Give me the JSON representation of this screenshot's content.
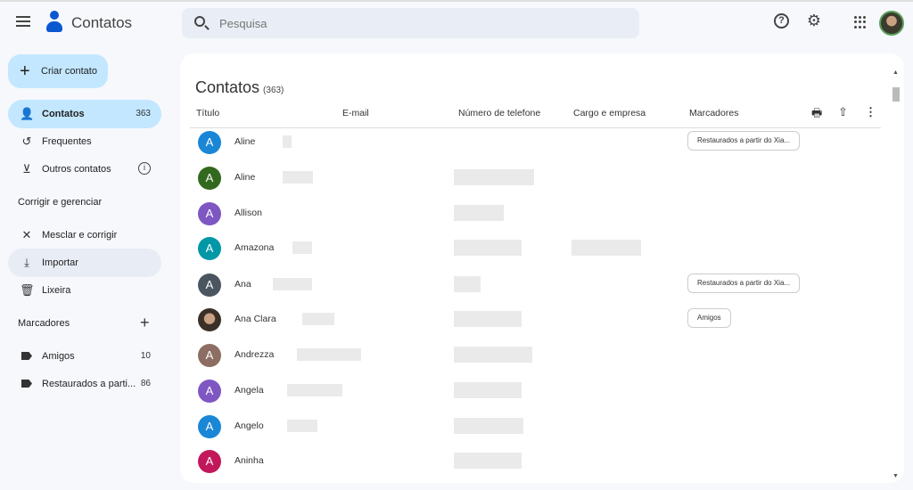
{
  "app": {
    "title": "Contatos"
  },
  "search": {
    "placeholder": "Pesquisa"
  },
  "topbar": {
    "help_glyph": "?",
    "settings_glyph": "⚙"
  },
  "sidebar": {
    "create_label": "Criar contato",
    "items": [
      {
        "label": "Contatos",
        "count": "363",
        "icon": "person-icon"
      },
      {
        "label": "Frequentes",
        "icon": "history-icon"
      },
      {
        "label": "Outros contatos",
        "icon": "archive-download-icon"
      }
    ],
    "fix_section": "Corrigir e gerenciar",
    "fix_items": [
      {
        "label": "Mesclar e corrigir",
        "icon": "tools-icon"
      },
      {
        "label": "Importar",
        "icon": "download-icon"
      },
      {
        "label": "Lixeira",
        "icon": "trash-icon"
      }
    ],
    "labels_section": "Marcadores",
    "labels": [
      {
        "label": "Amigos",
        "count": "10"
      },
      {
        "label": "Restaurados a parti...",
        "count": "86"
      }
    ]
  },
  "main": {
    "title": "Contatos",
    "count": "(363)",
    "columns": [
      "Título",
      "E-mail",
      "Número de telefone",
      "Cargo e empresa",
      "Marcadores"
    ],
    "rows": [
      {
        "initial": "A",
        "name": "Aline",
        "color": "#1a86d6",
        "chip": "Restaurados a partir do Xia..."
      },
      {
        "initial": "A",
        "name": "Aline",
        "color": "#33691e",
        "phone": true
      },
      {
        "initial": "A",
        "name": "Allison",
        "color": "#7e57c2",
        "phone": true
      },
      {
        "initial": "A",
        "name": "Amazona",
        "color": "#0097a7",
        "phone": true,
        "job": true
      },
      {
        "initial": "A",
        "name": "Ana",
        "color": "#4a5560",
        "phone": true,
        "chip": "Restaurados a partir do Xia..."
      },
      {
        "initial": "",
        "name": "Ana Clara",
        "color": "#5a4a3a",
        "phone": true,
        "chip": "Amigos"
      },
      {
        "initial": "A",
        "name": "Andrezza",
        "color": "#8d6e63",
        "phone": true
      },
      {
        "initial": "A",
        "name": "Angela",
        "color": "#7e57c2",
        "phone": true
      },
      {
        "initial": "A",
        "name": "Angelo",
        "color": "#1a86d6",
        "phone": true
      },
      {
        "initial": "A",
        "name": "Aninha",
        "color": "#c2185b",
        "phone": true
      }
    ]
  }
}
